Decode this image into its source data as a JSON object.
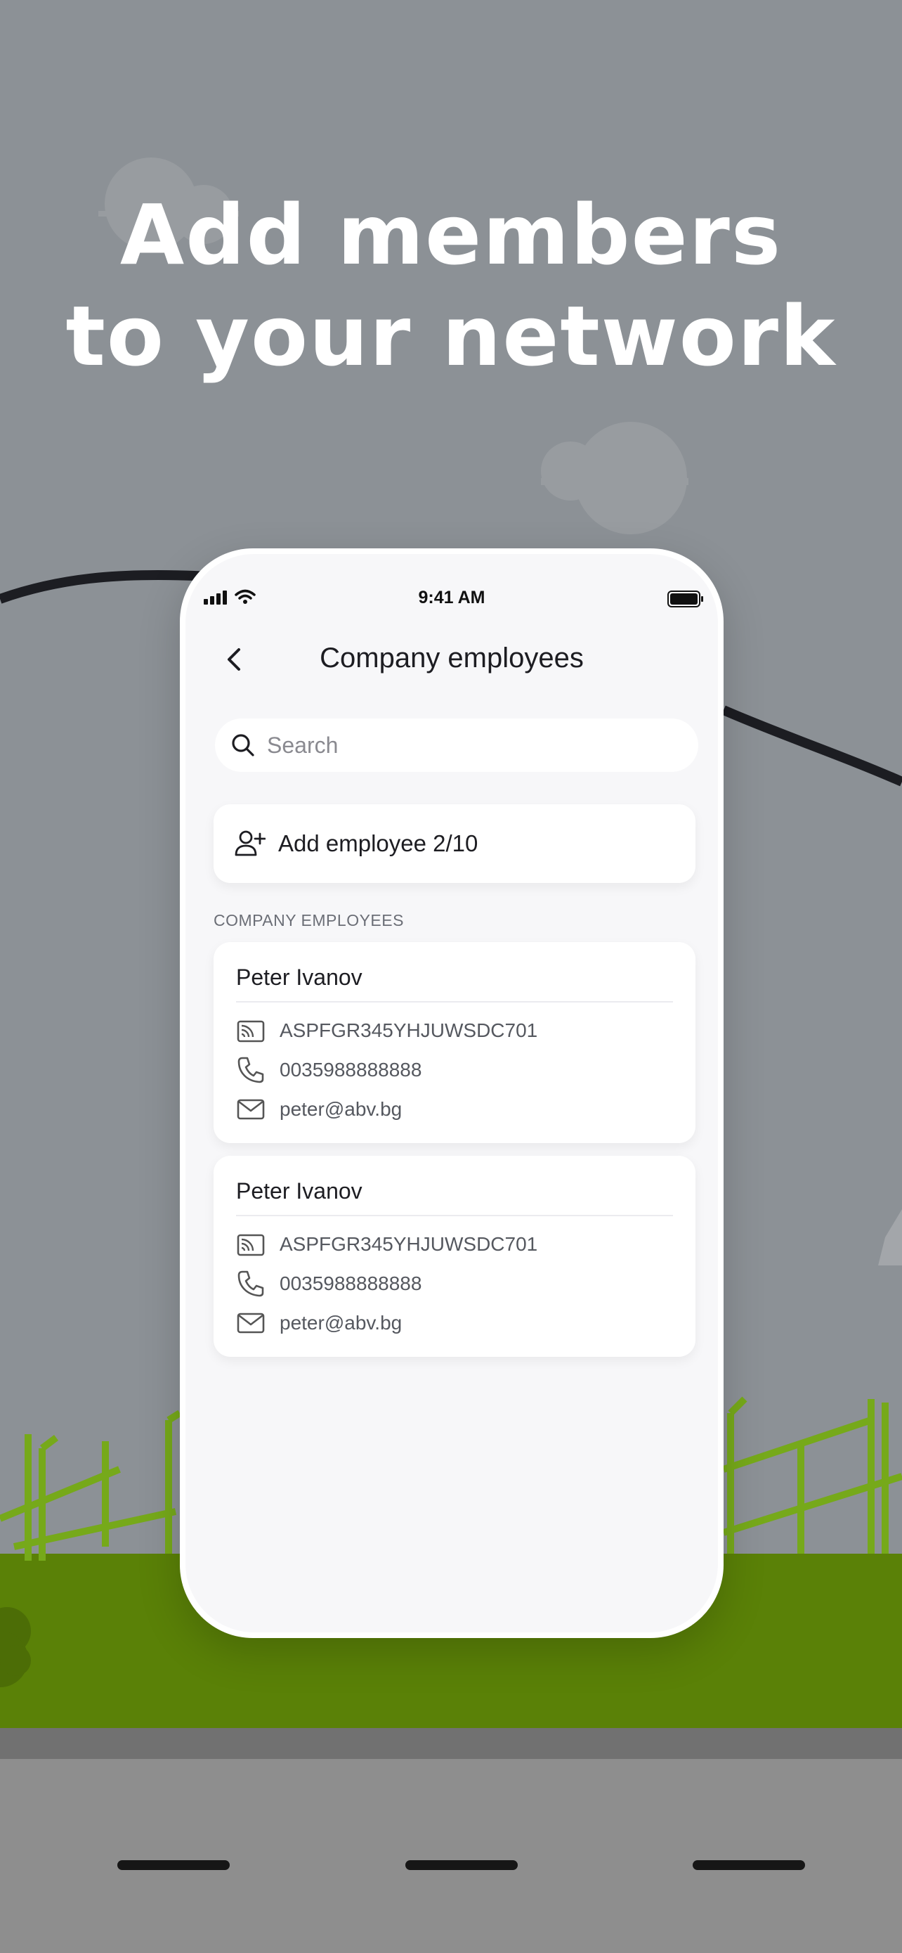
{
  "headline": {
    "line1": "Add members",
    "line2": "to your network"
  },
  "status_bar": {
    "time": "9:41 AM"
  },
  "nav": {
    "title": "Company employees"
  },
  "search": {
    "placeholder": "Search",
    "value": ""
  },
  "add_employee": {
    "label": "Add employee 2/10"
  },
  "section": {
    "label": "COMPANY EMPLOYEES"
  },
  "employees": [
    {
      "name": "Peter Ivanov",
      "card_id": "ASPFGR345YHJUWSDC701",
      "phone": "0035988888888",
      "email": "peter@abv.bg"
    },
    {
      "name": "Peter Ivanov",
      "card_id": "ASPFGR345YHJUWSDC701",
      "phone": "0035988888888",
      "email": "peter@abv.bg"
    }
  ],
  "icons": {
    "back": "chevron-left-icon",
    "search": "search-icon",
    "add_user": "add-user-icon",
    "card": "card-icon",
    "phone": "phone-icon",
    "email": "mail-icon"
  },
  "colors": {
    "background": "#8c9196",
    "grass": "#5a8107",
    "grass_highlight": "#76a91a",
    "screen_bg": "#f7f7f9",
    "text_primary": "#1d1d22",
    "text_secondary": "#55585f"
  }
}
